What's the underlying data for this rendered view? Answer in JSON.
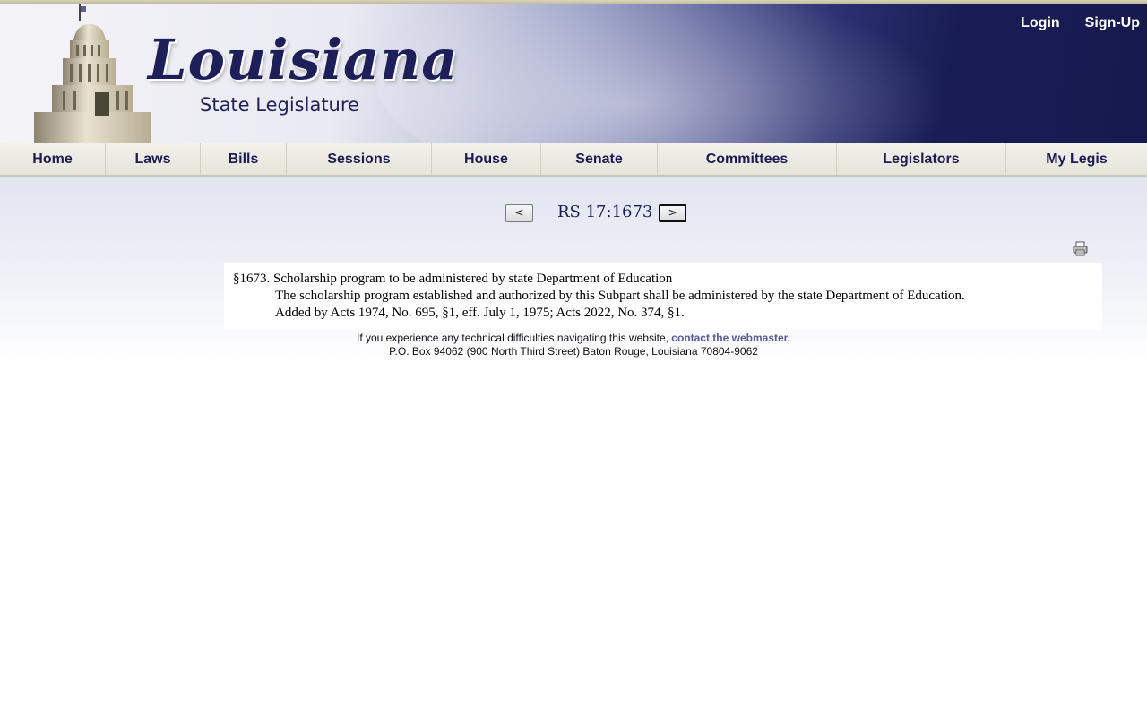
{
  "header": {
    "logo_script": "Louisiana",
    "logo_subtitle": "State Legislature",
    "login_label": "Login",
    "signup_label": "Sign-Up"
  },
  "nav": {
    "items": [
      {
        "label": "Home"
      },
      {
        "label": "Laws"
      },
      {
        "label": "Bills"
      },
      {
        "label": "Sessions"
      },
      {
        "label": "House"
      },
      {
        "label": "Senate"
      },
      {
        "label": "Committees"
      },
      {
        "label": "Legislators"
      },
      {
        "label": "My Legis"
      }
    ]
  },
  "pager": {
    "prev_label": "<",
    "next_label": ">",
    "title": "RS 17:1673"
  },
  "law": {
    "title": "§1673. Scholarship program to be administered by state Department of Education",
    "body": "The scholarship program established and authorized by this Subpart shall be administered by the state Department of Education.",
    "history": "Added by Acts 1974, No. 695, §1, eff. July 1, 1975; Acts 2022, No. 374, §1."
  },
  "footer": {
    "tech_text": "If you experience any technical difficulties navigating this website, ",
    "webmaster_link": "contact the webmaster.",
    "address": "P.O. Box 94062 (900 North Third Street) Baton Rouge, Louisiana 70804-9062"
  },
  "icons": {
    "print": "print-icon"
  },
  "colors": {
    "brand_navy": "#1a1d55",
    "link": "#555d9b",
    "nav_bg": "#e9e7de"
  }
}
